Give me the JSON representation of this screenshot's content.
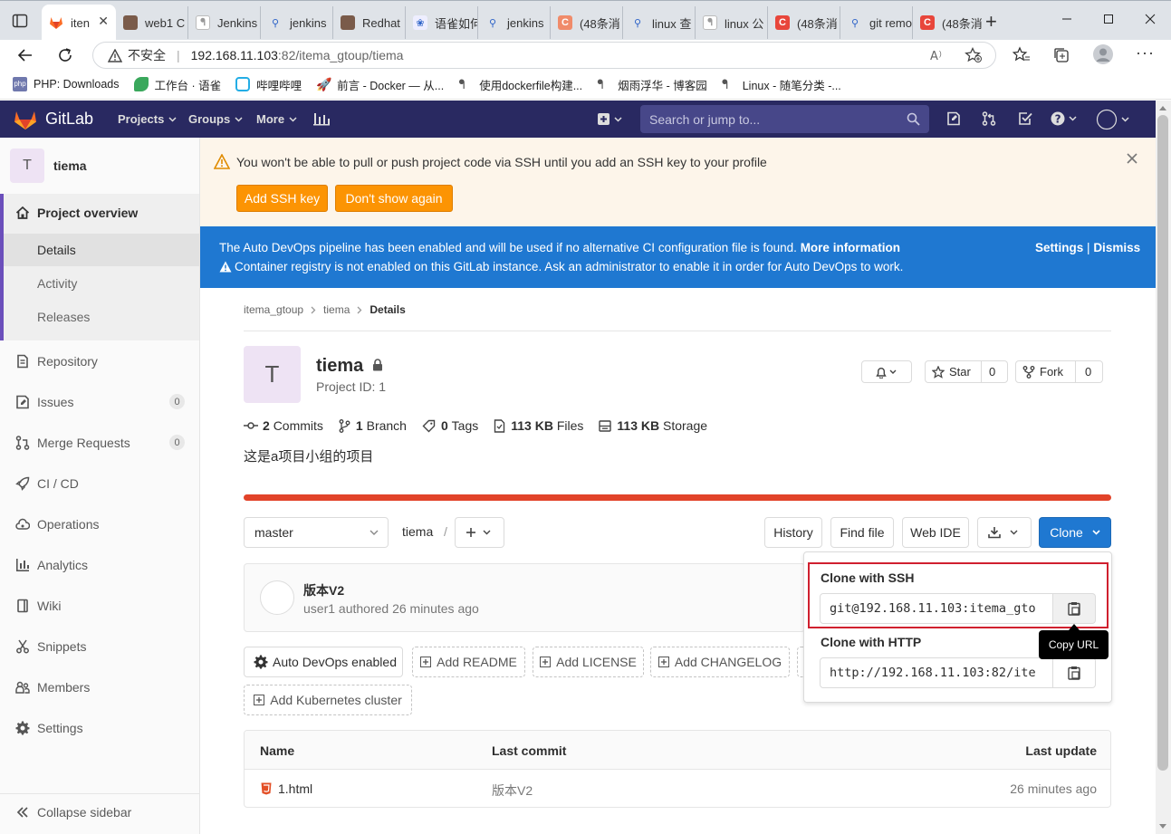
{
  "browser": {
    "tabs": [
      {
        "label": "iten",
        "active": true
      },
      {
        "label": "web1 C"
      },
      {
        "label": "Jenkins"
      },
      {
        "label": "jenkins"
      },
      {
        "label": "Redhat"
      },
      {
        "label": "语雀如何"
      },
      {
        "label": "jenkins"
      },
      {
        "label": "(48条消"
      },
      {
        "label": "linux 查"
      },
      {
        "label": "linux 公"
      },
      {
        "label": "(48条消"
      },
      {
        "label": "git remo"
      },
      {
        "label": "(48条消"
      }
    ],
    "security_label": "不安全",
    "url_host": "192.168.11.103",
    "url_rest": ":82/itema_gtoup/tiema",
    "bookmarks": [
      {
        "label": "PHP: Downloads",
        "icon": "php-icon"
      },
      {
        "label": "工作台 · 语雀",
        "icon": "yuque-icon"
      },
      {
        "label": "哔哩哔哩",
        "icon": "bilibili-icon"
      },
      {
        "label": "前言 - Docker — 从...",
        "icon": "rocket-icon"
      },
      {
        "label": "使用dockerfile构建...",
        "icon": "cnblogs-icon"
      },
      {
        "label": "烟雨浮华 - 博客园",
        "icon": "cnblogs-icon"
      },
      {
        "label": "Linux - 随笔分类 -...",
        "icon": "cnblogs-icon"
      }
    ]
  },
  "gitlab": {
    "brand": "GitLab",
    "nav": {
      "projects": "Projects",
      "groups": "Groups",
      "more": "More"
    },
    "search_placeholder": "Search or jump to..."
  },
  "sidebar": {
    "avatar_letter": "T",
    "project_name": "tiema",
    "project_overview": "Project overview",
    "sub": {
      "details": "Details",
      "activity": "Activity",
      "releases": "Releases"
    },
    "items": [
      {
        "label": "Repository",
        "icon": "repository-icon"
      },
      {
        "label": "Issues",
        "icon": "issues-icon",
        "count": "0"
      },
      {
        "label": "Merge Requests",
        "icon": "merge-request-icon",
        "count": "0"
      },
      {
        "label": "CI / CD",
        "icon": "rocket-icon"
      },
      {
        "label": "Operations",
        "icon": "cloud-icon"
      },
      {
        "label": "Analytics",
        "icon": "chart-icon"
      },
      {
        "label": "Wiki",
        "icon": "book-icon"
      },
      {
        "label": "Snippets",
        "icon": "scissors-icon"
      },
      {
        "label": "Members",
        "icon": "users-icon"
      },
      {
        "label": "Settings",
        "icon": "gear-icon"
      }
    ],
    "collapse": "Collapse sidebar"
  },
  "alerts": {
    "ssh_warning": "You won't be able to pull or push project code via SSH until you add an SSH key to your profile",
    "add_ssh": "Add SSH key",
    "dont_show": "Don't show again",
    "devops_line1": "The Auto DevOps pipeline has been enabled and will be used if no alternative CI configuration file is found.",
    "more_info": "More information",
    "devops_line2": "Container registry is not enabled on this GitLab instance. Ask an administrator to enable it in order for Auto DevOps to work.",
    "settings": "Settings",
    "pipe": "|",
    "dismiss": "Dismiss"
  },
  "breadcrumb": {
    "group": "itema_gtoup",
    "project": "tiema",
    "current": "Details"
  },
  "project": {
    "avatar_letter": "T",
    "name": "tiema",
    "id_label": "Project ID: 1",
    "star": "Star",
    "star_count": "0",
    "fork": "Fork",
    "fork_count": "0",
    "stats": [
      {
        "num": "2",
        "label": "Commits",
        "icon": "commit-icon"
      },
      {
        "num": "1",
        "label": "Branch",
        "icon": "branch-icon"
      },
      {
        "num": "0",
        "label": "Tags",
        "icon": "tag-icon"
      },
      {
        "num": "113 KB",
        "label": "Files",
        "icon": "file-icon"
      },
      {
        "num": "113 KB",
        "label": "Storage",
        "icon": "storage-icon"
      }
    ],
    "description": "这是a项目小组的项目"
  },
  "repo": {
    "branch": "master",
    "path": "tiema",
    "slash": "/",
    "history": "History",
    "find_file": "Find file",
    "web_ide": "Web IDE",
    "clone": "Clone"
  },
  "commit": {
    "title": "版本V2",
    "meta": "user1 authored 26 minutes ago"
  },
  "actions": {
    "auto_devops": "Auto DevOps enabled",
    "readme": "Add README",
    "license": "Add LICENSE",
    "changelog": "Add CHANGELOG",
    "k8s": "Add Kubernetes cluster"
  },
  "clone_dropdown": {
    "ssh_title": "Clone with SSH",
    "ssh_url": "git@192.168.11.103:itema_gto",
    "http_title": "Clone with HTTP",
    "http_url": "http://192.168.11.103:82/ite",
    "tooltip": "Copy URL"
  },
  "files": {
    "headers": {
      "name": "Name",
      "last_commit": "Last commit",
      "last_update": "Last update"
    },
    "rows": [
      {
        "name": "1.html",
        "commit": "版本V2",
        "updated": "26 minutes ago"
      }
    ]
  },
  "colors": {
    "gitlab_nav": "#292961",
    "warning_bg": "#fdf5ea",
    "warning_button": "#fc9403",
    "info_banner": "#1f78d1",
    "progress_bar": "#e24329",
    "clone_button": "#1f78d1",
    "highlight_box": "#d0202f"
  }
}
